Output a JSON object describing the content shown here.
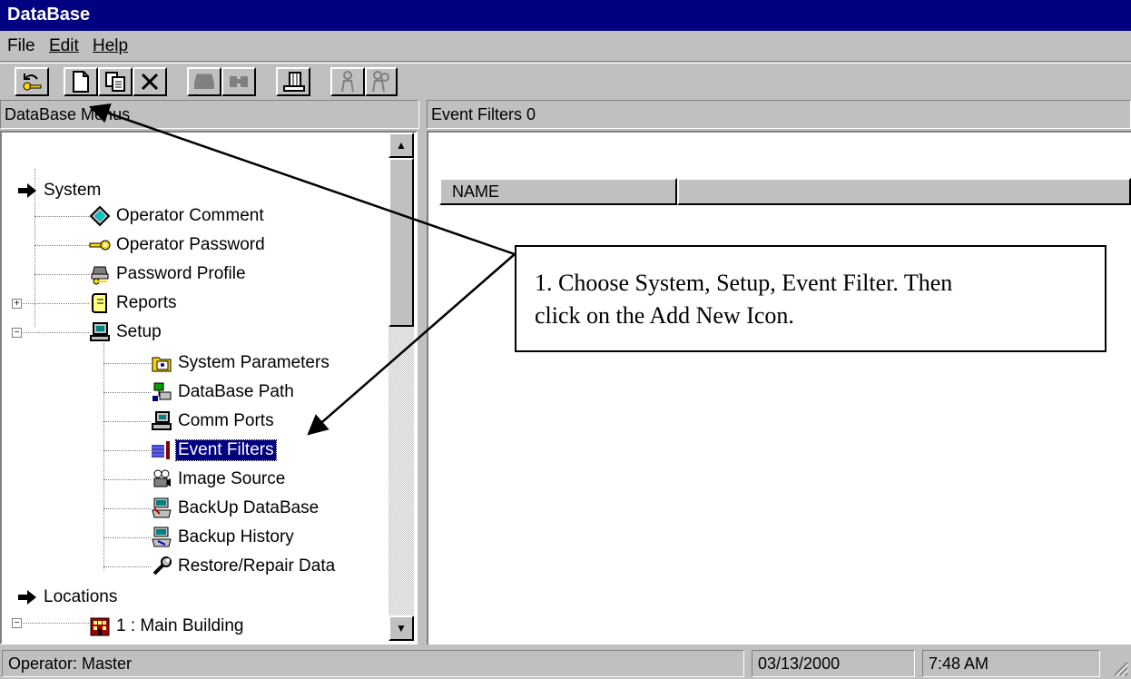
{
  "window": {
    "title": "DataBase"
  },
  "menu": {
    "file": "File",
    "edit": "Edit",
    "help": "Help"
  },
  "toolbar": {
    "buttons": [
      "exit-icon",
      "add-new-icon",
      "copy-icon",
      "delete-icon",
      "print-icon",
      "print-preview-icon",
      "report-icon",
      "operator-icon",
      "operators-icon"
    ]
  },
  "left_panel": {
    "header": "DataBase Menus"
  },
  "tree": {
    "system": "System",
    "operator_comment": "Operator Comment",
    "operator_password": "Operator Password",
    "password_profile": "Password Profile",
    "reports": "Reports",
    "setup": "Setup",
    "system_parameters": "System Parameters",
    "database_path": "DataBase Path",
    "comm_ports": "Comm Ports",
    "event_filters": "Event Filters",
    "image_source": "Image Source",
    "backup_database": "BackUp DataBase",
    "backup_history": "Backup History",
    "restore_repair": "Restore/Repair Data",
    "locations": "Locations",
    "main_building": "1 : Main Building"
  },
  "right_panel": {
    "header": "Event Filters  0",
    "column_name": "NAME"
  },
  "callout": {
    "line1": "1. Choose System, Setup, Event Filter. Then",
    "line2": "click on the Add New Icon."
  },
  "status": {
    "operator": "Operator:  Master",
    "date": "03/13/2000",
    "time": "7:48 AM"
  },
  "colors": {
    "titlebar": "#000080",
    "face": "#c0c0c0",
    "selection": "#000080"
  }
}
